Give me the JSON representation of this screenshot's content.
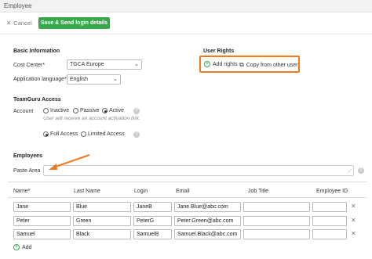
{
  "window": {
    "title": "Employee"
  },
  "toolbar": {
    "cancel_label": "Cancel",
    "save_label": "Save & Send login details"
  },
  "basic": {
    "heading": "Basic Information",
    "cost_center_label": "Cost Center*",
    "cost_center_value": "TGCA Europe",
    "language_label": "Application language*",
    "language_value": "English"
  },
  "rights": {
    "heading": "User Rights",
    "add_label": "Add rights",
    "copy_label": "Copy from other user"
  },
  "access": {
    "heading": "TeamGuru Access",
    "account_label": "Account",
    "options": [
      "Inactive",
      "Passive",
      "Active"
    ],
    "selected": "Active",
    "hint": "User will receive an account activation link.",
    "access_options": [
      "Full Access",
      "Limited Access"
    ],
    "access_selected": "Full Access"
  },
  "employees": {
    "heading": "Employees",
    "paste_label": "Paste Area",
    "columns": [
      "Name*",
      "Last Name",
      "Login",
      "Email",
      "Job Title",
      "Employee ID"
    ],
    "rows": [
      [
        "Jane",
        "Blue",
        "JaneB",
        "Jane.Blue@abc.com",
        "",
        ""
      ],
      [
        "Peter",
        "Green",
        "PeterG",
        "Peter.Green@abc.com",
        "",
        ""
      ],
      [
        "Samuel",
        "Black",
        "SamuelB",
        "Samuel.Black@abc.com",
        "",
        ""
      ]
    ],
    "add_label": "Add"
  },
  "colors": {
    "accent": "#37a84b",
    "highlight": "#f07b1f"
  }
}
